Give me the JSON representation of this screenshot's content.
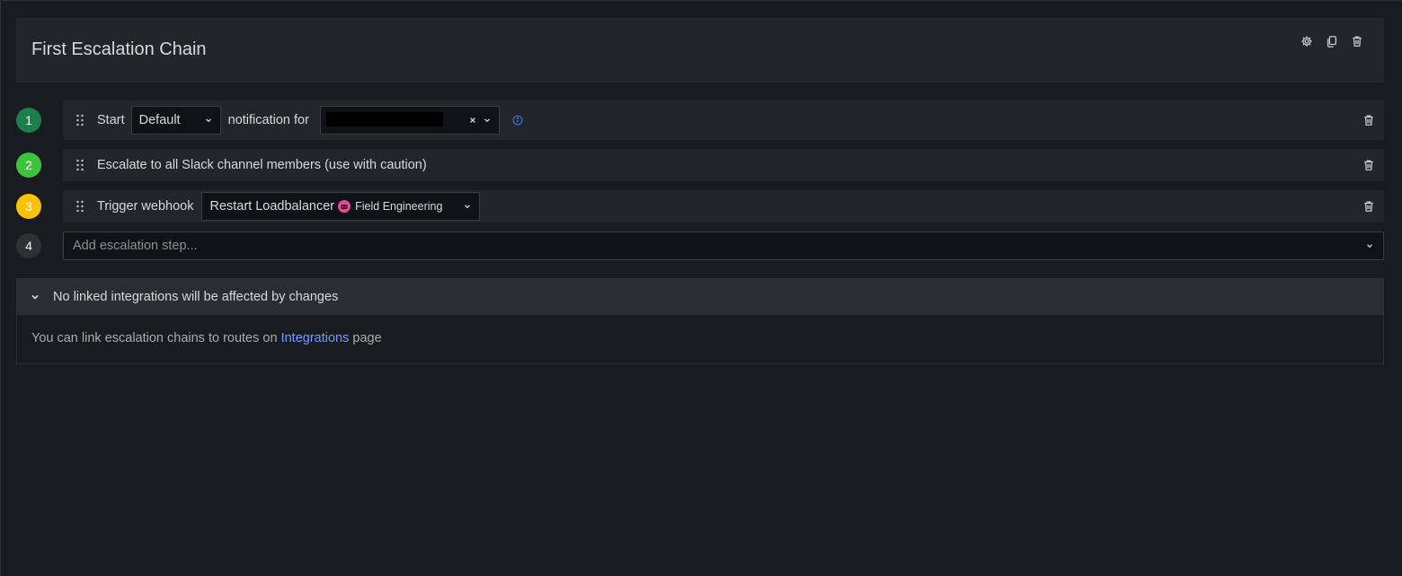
{
  "header": {
    "title": "First Escalation Chain",
    "actions": [
      "settings",
      "copy",
      "delete"
    ]
  },
  "steps": [
    {
      "number": "1",
      "color": "#1a7f4b",
      "start_label": "Start",
      "importance_value": "Default",
      "notification_for_label": "notification for"
    },
    {
      "number": "2",
      "color": "#3dc43d",
      "text": "Escalate to all Slack channel members (use with caution)"
    },
    {
      "number": "3",
      "color": "#fbc105",
      "label": "Trigger webhook",
      "webhook_name": "Restart Loadbalancer",
      "team_name": "Field Engineering"
    },
    {
      "number": "4",
      "color": "#2e3036",
      "placeholder": "Add escalation step..."
    }
  ],
  "linked": {
    "title": "No linked integrations will be affected by changes",
    "body_prefix": "You can link escalation chains to routes on",
    "link_text": "Integrations",
    "body_suffix": "page"
  },
  "colors": {
    "accent_link": "#6e9fff",
    "info": "#3d71d9"
  }
}
